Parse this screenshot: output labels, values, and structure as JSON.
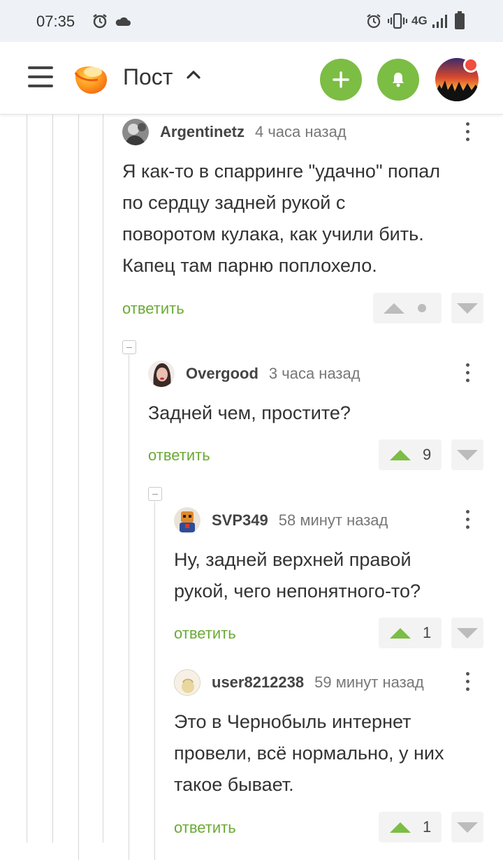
{
  "status_bar": {
    "time": "07:35",
    "network": "4G"
  },
  "header": {
    "title": "Пост"
  },
  "colors": {
    "accent_green": "#7cbd44",
    "reply_green": "#6aaa35",
    "notification_red": "#f04e3e"
  },
  "comments": [
    {
      "user": "Argentinetz",
      "time": "4 часа назад",
      "lines": [
        "Я как-то в спарринге \"удачно\" попал",
        "по сердцу задней рукой с",
        "поворотом кулака, как учили бить.",
        "Капец там парню поплохело."
      ],
      "reply": "ответить",
      "votes": ""
    },
    {
      "user": "Overgood",
      "time": "3 часа назад",
      "lines": [
        "Задней чем, простите?"
      ],
      "reply": "ответить",
      "votes": "9"
    },
    {
      "user": "SVP349",
      "time": "58 минут назад",
      "lines": [
        "Ну, задней верхней правой",
        "рукой, чего непонятного-то?"
      ],
      "reply": "ответить",
      "votes": "1"
    },
    {
      "user": "user8212238",
      "time": "59 минут назад",
      "lines": [
        "Это в Чернобыль интернет",
        "провели, всё нормально, у них",
        "такое бывает."
      ],
      "reply": "ответить",
      "votes": "1"
    }
  ]
}
